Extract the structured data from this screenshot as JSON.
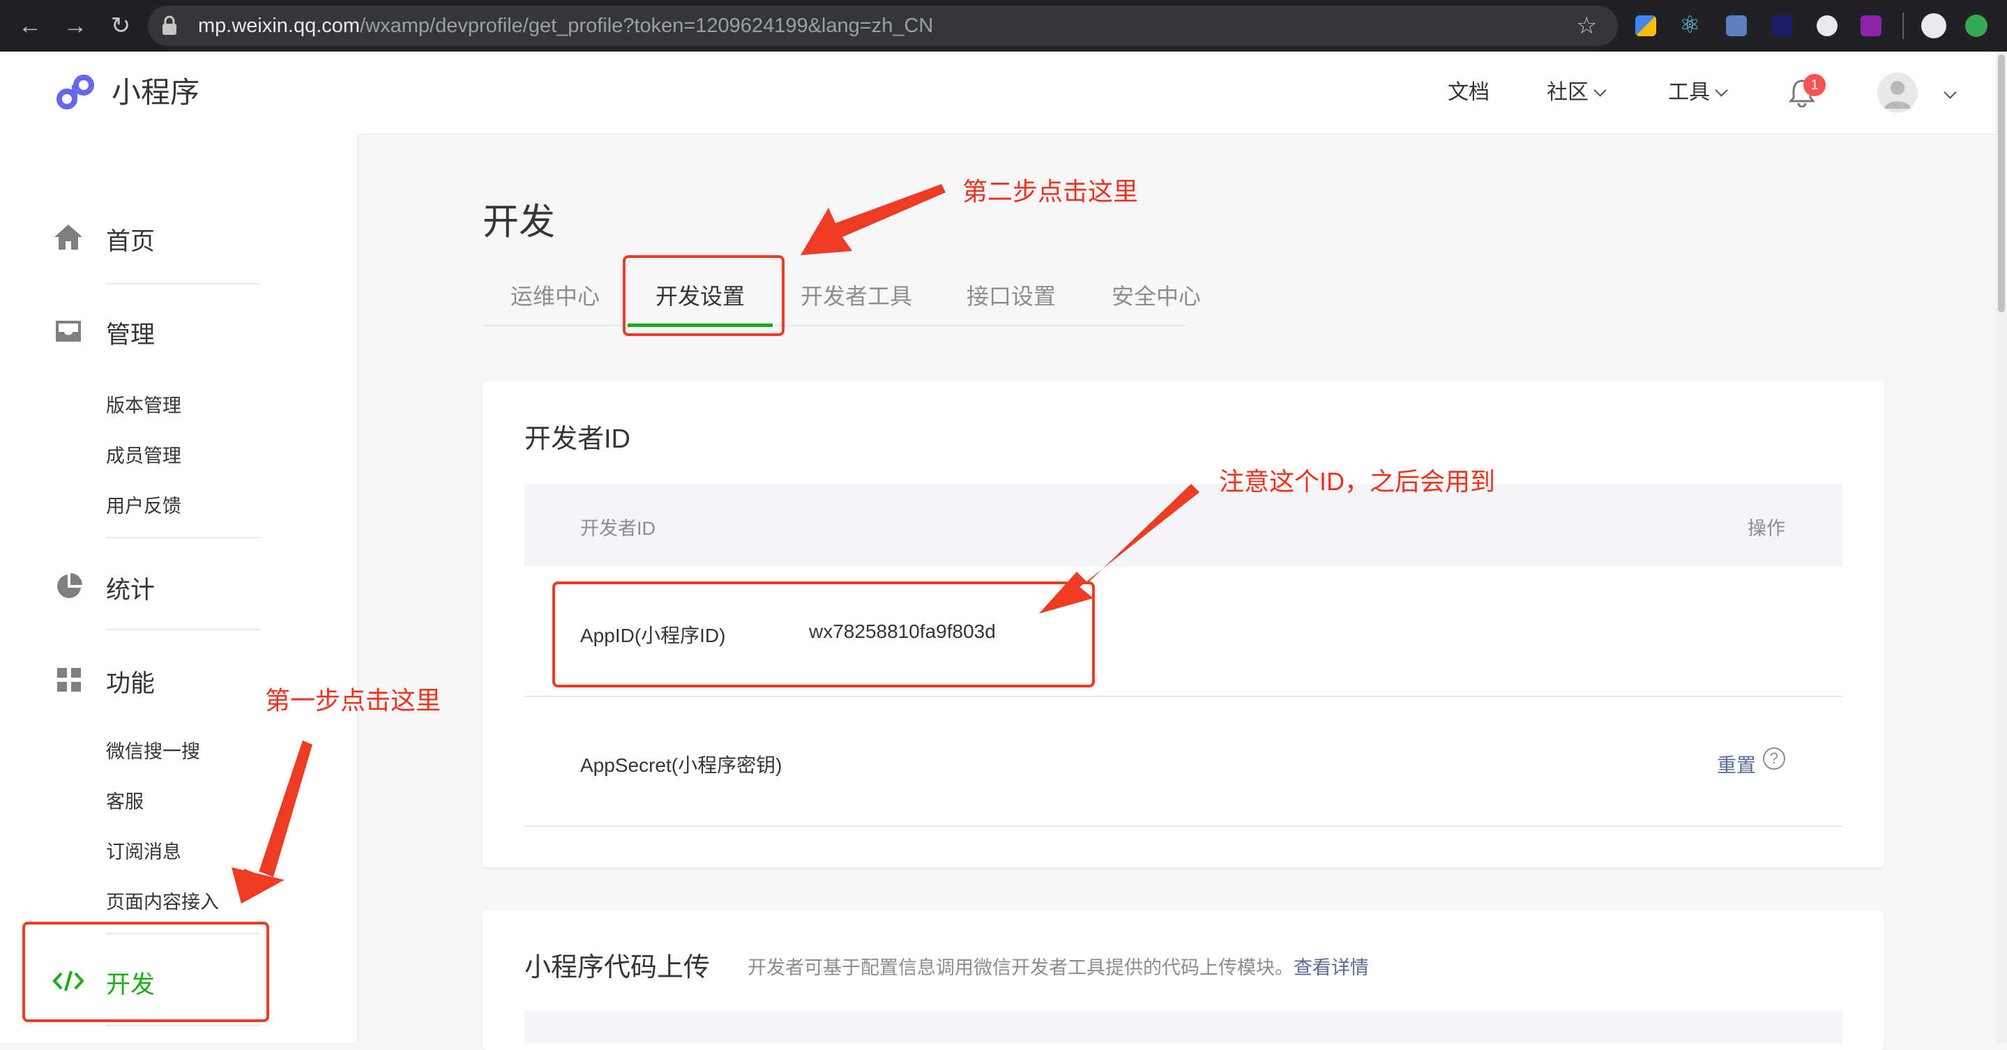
{
  "browser": {
    "url_host": "mp.weixin.qq.com",
    "url_path": "/wxamp/devprofile/get_profile?token=1209624199&lang=zh_CN"
  },
  "header": {
    "logo_text": "小程序",
    "nav": [
      {
        "label": "文档"
      },
      {
        "label": "社区"
      },
      {
        "label": "工具"
      }
    ],
    "notification_count": "1"
  },
  "sidebar": {
    "home": "首页",
    "manage": "管理",
    "manage_items": [
      "版本管理",
      "成员管理",
      "用户反馈"
    ],
    "stats": "统计",
    "features": "功能",
    "feature_items": [
      "微信搜一搜",
      "客服",
      "订阅消息",
      "页面内容接入"
    ],
    "develop": "开发"
  },
  "main": {
    "title": "开发",
    "tabs": [
      "运维中心",
      "开发设置",
      "开发者工具",
      "接口设置",
      "安全中心"
    ],
    "dev_id_card": {
      "title": "开发者ID",
      "col_id": "开发者ID",
      "col_op": "操作",
      "appid_label": "AppID(小程序ID)",
      "appid_value": "wx78258810fa9f803d",
      "appsecret_label": "AppSecret(小程序密钥)",
      "reset_label": "重置",
      "help_glyph": "?"
    },
    "upload_card": {
      "title": "小程序代码上传",
      "desc": "开发者可基于配置信息调用微信开发者工具提供的代码上传模块。",
      "detail_link": "查看详情"
    }
  },
  "annotations": {
    "step1": "第一步点击这里",
    "step2": "第二步点击这里",
    "note": "注意这个ID，之后会用到"
  },
  "colors": {
    "accent_green": "#1aad19",
    "annotation_red": "#f2311d",
    "link_blue": "#576b95"
  }
}
